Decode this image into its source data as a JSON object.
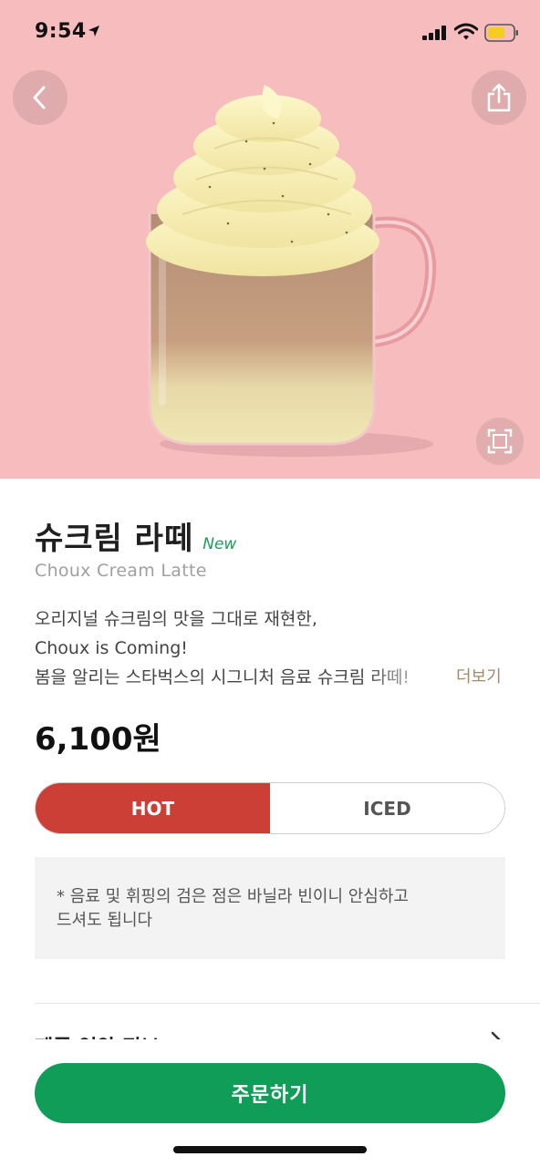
{
  "status_bar": {
    "time": "9:54"
  },
  "product": {
    "title": "슈크림 라떼",
    "badge": "New",
    "subtitle": "Choux Cream Latte",
    "description_lines": [
      "오리지널 슈크림의 맛을 그대로 재현한,",
      "Choux is Coming!",
      "봄을 알리는 스타벅스의 시그니처 음료 슈크림 라떼!"
    ],
    "more_label": "더보기",
    "price": "6,100원"
  },
  "temperature_toggle": {
    "options": [
      "HOT",
      "ICED"
    ],
    "selected": "HOT"
  },
  "notice": {
    "lines": [
      "* 음료 및 휘핑의 검은 점은 바닐라 빈이니 안심하고",
      "드셔도 됩니다"
    ]
  },
  "partial_row_label": "제품 영양 정보",
  "order_button": {
    "label": "주문하기"
  },
  "colors": {
    "hero_bg": "#f6bcbe",
    "hot_red": "#cc3f36",
    "order_green": "#0f9d58",
    "new_badge_green": "#1f9b58",
    "more_brown": "#a38a6a"
  },
  "icons": [
    "location-arrow-icon",
    "signal-icon",
    "wifi-icon",
    "battery-icon",
    "back-arrow-icon",
    "share-icon",
    "zoom-icon",
    "chevron-right-icon"
  ]
}
